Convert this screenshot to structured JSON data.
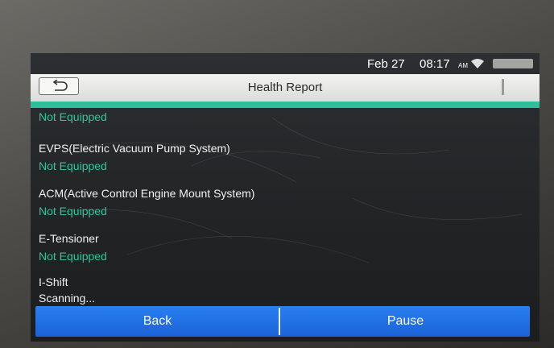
{
  "status_bar": {
    "date": "Feb 27",
    "time": "08:17",
    "ampm": "AM"
  },
  "header": {
    "title": "Health Report"
  },
  "items": [
    {
      "name": "",
      "status": "Not Equipped",
      "status_color": "#31c49c"
    },
    {
      "name": "EVPS(Electric Vacuum Pump System)",
      "status": "Not Equipped",
      "status_color": "#31c49c"
    },
    {
      "name": "ACM(Active Control Engine Mount System)",
      "status": "Not Equipped",
      "status_color": "#31c49c"
    },
    {
      "name": "E-Tensioner",
      "status": "Not Equipped",
      "status_color": "#31c49c"
    },
    {
      "name": "I-Shift",
      "status": "Scanning...",
      "status_color": "#f2f2f2"
    }
  ],
  "footer": {
    "back_label": "Back",
    "pause_label": "Pause"
  },
  "colors": {
    "accent": "#2ebf9c",
    "button_blue": "#1f6fe5"
  },
  "icons": {
    "back": "back-arrow-icon",
    "wifi": "wifi-icon",
    "battery": "battery-icon"
  }
}
